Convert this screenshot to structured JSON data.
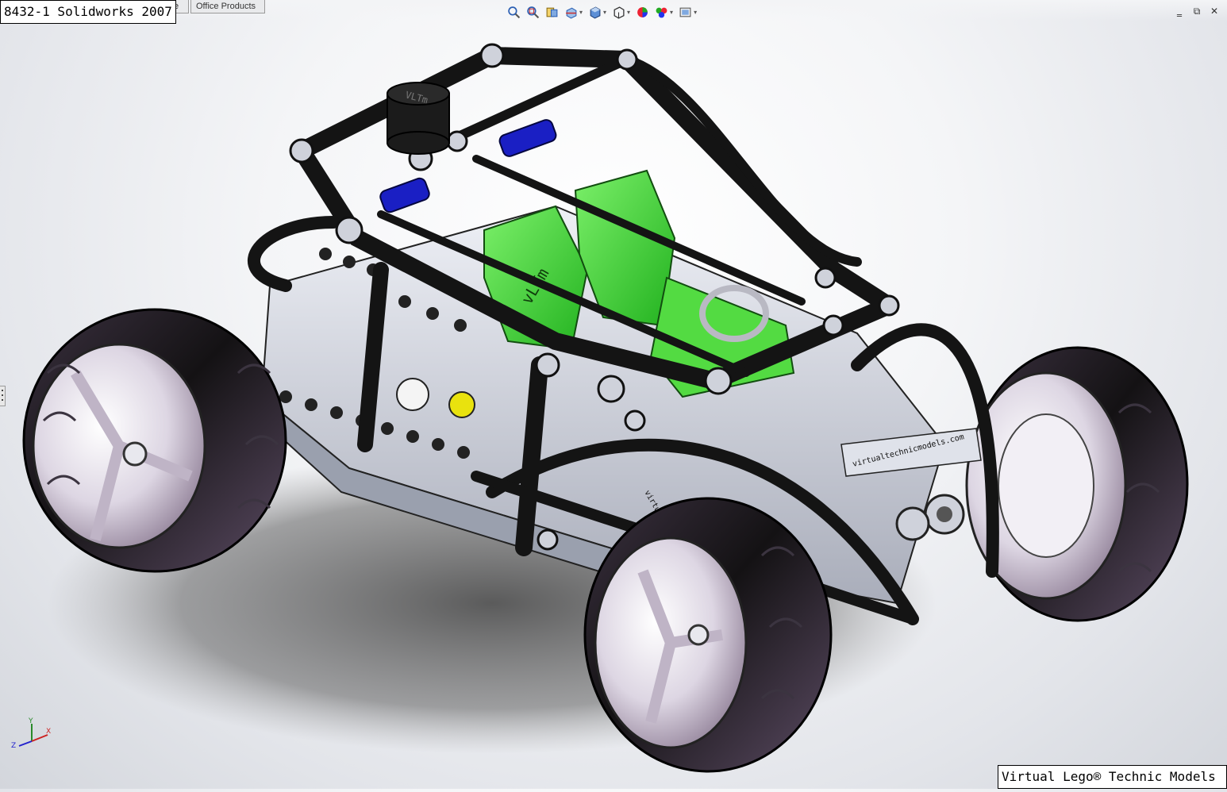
{
  "window": {
    "title_label": "8432-1 Solidworks 2007",
    "tabs": [
      {
        "label": "e"
      },
      {
        "label": "Office Products"
      }
    ],
    "controls": {
      "minimize": "‗",
      "restore": "⧉",
      "close": "✕"
    }
  },
  "heads_up_toolbar": {
    "icons": [
      "zoom-to-fit-icon",
      "zoom-to-area-icon",
      "previous-view-icon",
      "section-view-icon",
      "view-orientation-icon",
      "display-style-icon",
      "hide-show-items-icon",
      "edit-appearance-icon",
      "apply-scene-icon",
      "view-settings-icon"
    ]
  },
  "model": {
    "logo_text": "VLTm",
    "seat_logo": "vLTm",
    "side_text": "virtualtechnicmodels.com",
    "side_text_short": "virtualtec",
    "colors": {
      "frame": "#1c1c1c",
      "seat": "#3fd63a",
      "accent_blue": "#1a1fc4",
      "accent_yellow": "#e9e20e",
      "beam_gray": "#c8cbd4",
      "tire": "#141414",
      "rim": "#e4e0ea"
    }
  },
  "triad": {
    "x": "X",
    "y": "Y",
    "z": "Z"
  },
  "credit_label": "Virtual Lego® Technic Models"
}
